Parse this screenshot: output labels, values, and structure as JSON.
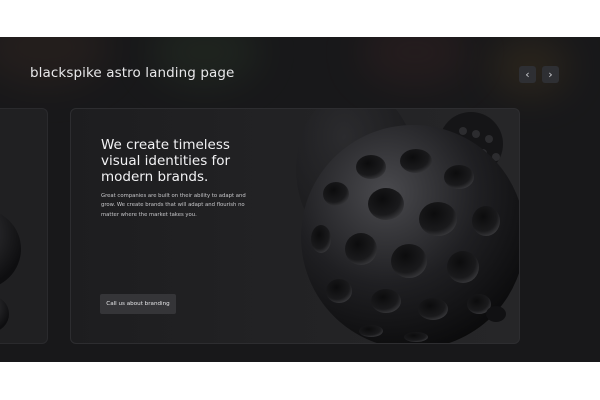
{
  "header": {
    "title": "blackspike astro landing page",
    "prev_icon": "‹",
    "next_icon": "›"
  },
  "hero": {
    "headline": "We create timeless visual identities for modern brands.",
    "body": "Great companies are built on their ability to adapt and grow. We create brands that will adapt and flourish no matter where the market takes you.",
    "cta_label": "Call us about branding"
  },
  "icons": {
    "prev": "chevron-left-icon",
    "next": "chevron-right-icon"
  },
  "colors": {
    "background": "#18181a",
    "card": "#222224",
    "button": "#353538",
    "text": "#f2f2f4"
  }
}
